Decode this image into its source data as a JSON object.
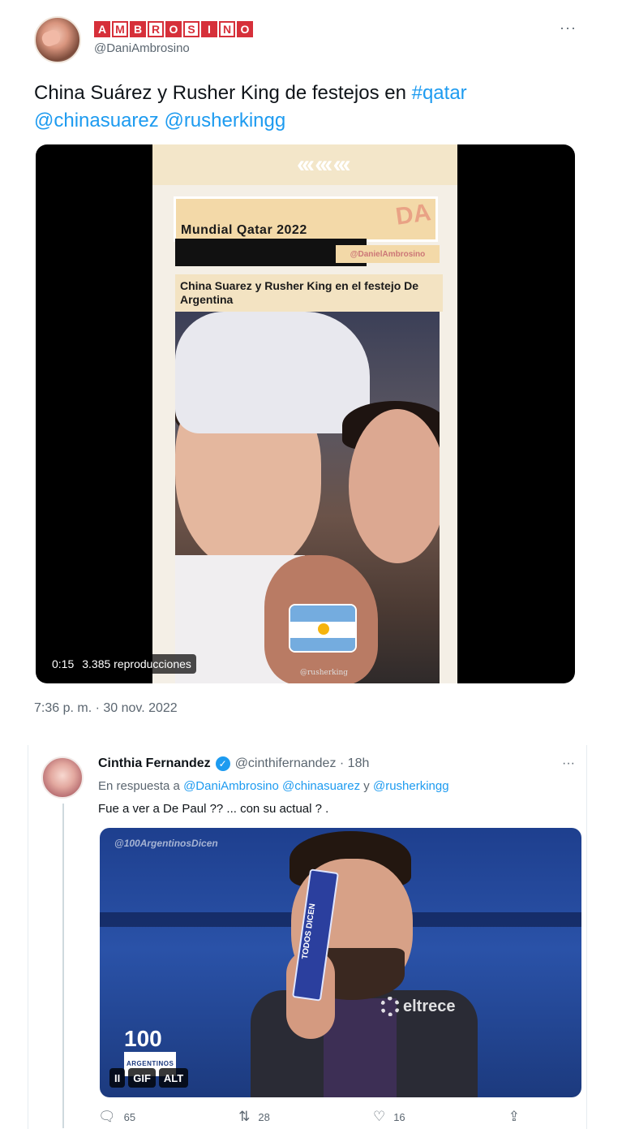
{
  "tweet1": {
    "display_name": "AMBROSINO",
    "display_name_letters": [
      "A",
      "M",
      "B",
      "R",
      "O",
      "S",
      "I",
      "N",
      "O"
    ],
    "handle": "@DaniAmbrosino",
    "more_label": "···",
    "text_plain": "China Suárez y Rusher King de festejos en ",
    "hashtag": "#qatar",
    "mention1": "@chinasuarez",
    "mention2": "@rusherkingg",
    "video": {
      "chevrons": "‹‹‹ ‹‹‹ ‹‹‹",
      "banner_title": "Mundial Qatar 2022",
      "banner_handle": "@DanielAmbrosino",
      "caption": "China Suarez y Rusher King en el festejo De Argentina",
      "watermark": "DA",
      "credit": "@rusherking",
      "duration": "0:15",
      "views": "3.385 reproducciones"
    },
    "timestamp": "7:36 p. m. · 30 nov. 2022"
  },
  "tweet2": {
    "display_name": "Cinthia Fernandez",
    "verified_icon": "✓",
    "handle": "@cinthifernandez · 18h",
    "more_label": "···",
    "reply_prefix": "En respuesta a ",
    "reply_mentions": "@DaniAmbrosino @chinasuarez",
    "reply_and": " y ",
    "reply_last": "@rusherkingg",
    "text": "Fue a ver a De Paul ?? ... con su actual ? .",
    "gif": {
      "watermark": "@100ArgentinosDicen",
      "card_text": "TODOS DICEN",
      "channel": "eltrece",
      "logo_number": "100",
      "logo_sub": "ARGENTINOS",
      "pause_label": "II",
      "gif_label": "GIF",
      "alt_label": "ALT"
    },
    "actions": {
      "replies": "65",
      "retweets": "28",
      "likes": "16"
    }
  },
  "colors": {
    "link": "#1d9bf0",
    "muted": "#5b6670",
    "brand_red": "#d6303a"
  },
  "icons": {
    "reply": "comment-icon",
    "retweet": "retweet-icon",
    "like": "heart-icon",
    "share": "share-icon"
  }
}
